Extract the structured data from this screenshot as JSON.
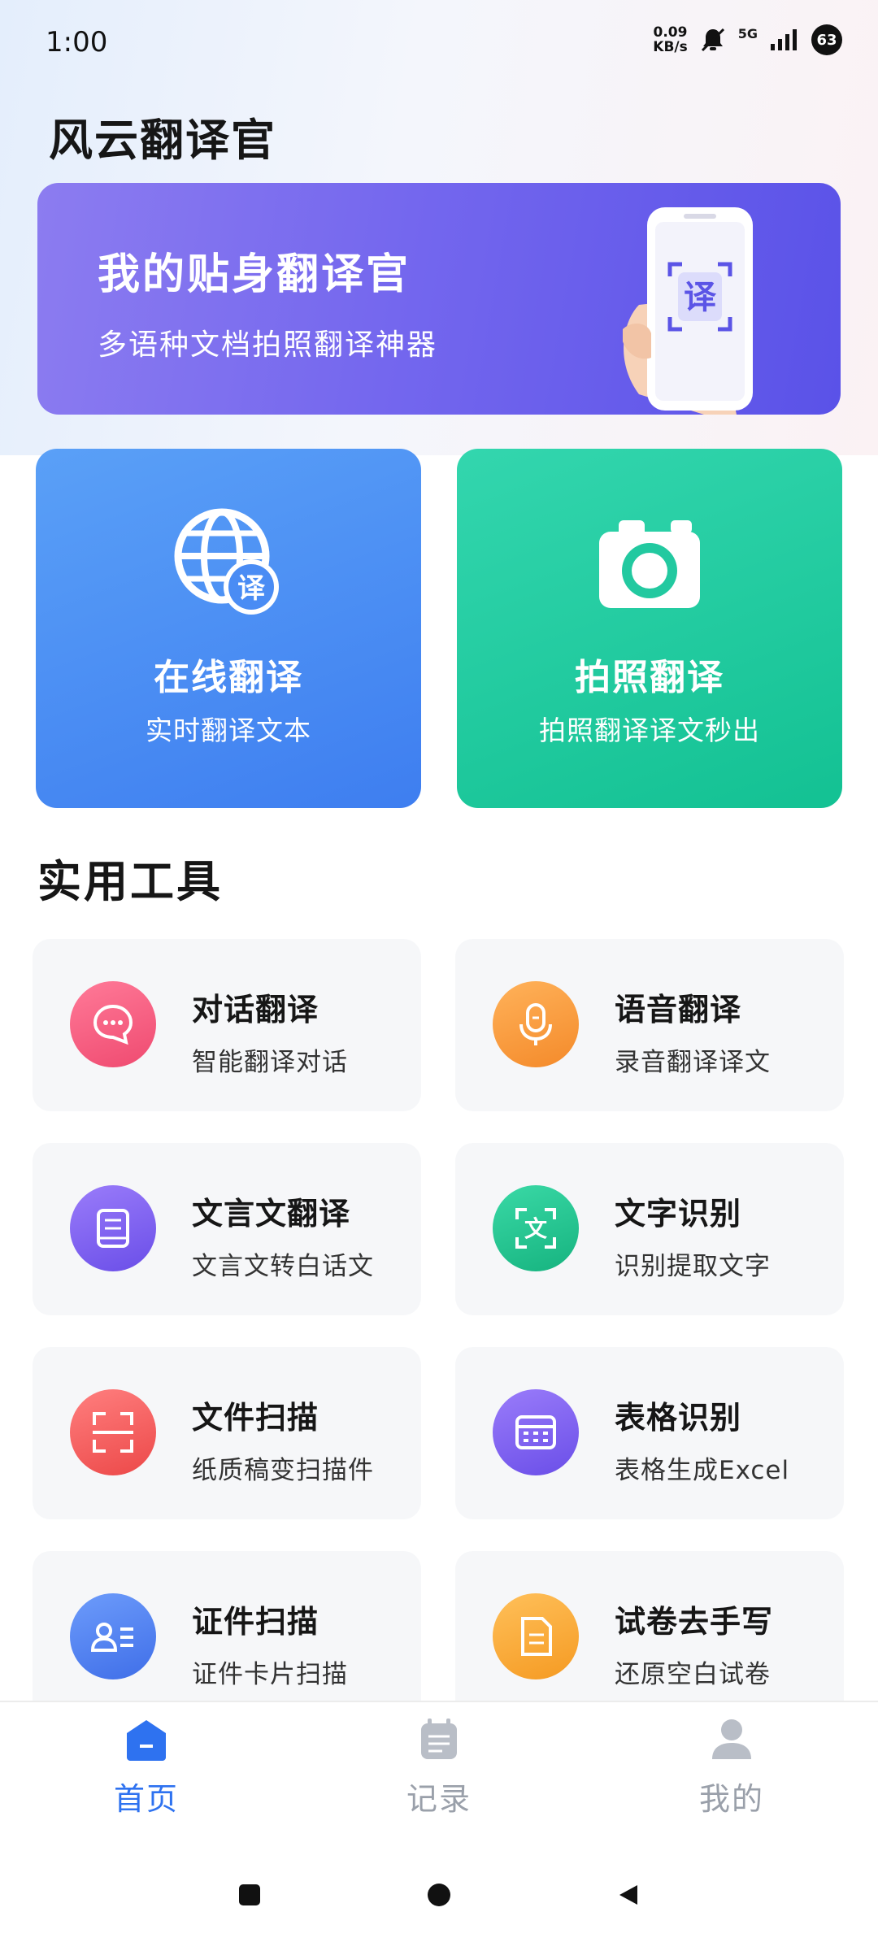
{
  "status_bar": {
    "time": "1:00",
    "net_speed_value": "0.09",
    "net_speed_unit": "KB/s",
    "network": "5G",
    "battery": "63"
  },
  "app": {
    "title": "风云翻译官"
  },
  "banner": {
    "title": "我的贴身翻译官",
    "subtitle": "多语种文档拍照翻译神器",
    "phone_glyph": "译"
  },
  "feature_cards": [
    {
      "title": "在线翻译",
      "subtitle": "实时翻译文本",
      "icon": "globe-translate-icon",
      "badge": "译",
      "color": "#4a8cf4"
    },
    {
      "title": "拍照翻译",
      "subtitle": "拍照翻译译文秒出",
      "icon": "camera-icon",
      "color": "#22c9a0"
    }
  ],
  "tools_section": {
    "title": "实用工具",
    "items": [
      {
        "title": "对话翻译",
        "subtitle": "智能翻译对话",
        "icon": "chat-bubble-icon",
        "color": "#f2567a"
      },
      {
        "title": "语音翻译",
        "subtitle": "录音翻译译文",
        "icon": "microphone-icon",
        "color": "#f99a3b"
      },
      {
        "title": "文言文翻译",
        "subtitle": "文言文转白话文",
        "icon": "book-icon",
        "color": "#7a5cf0"
      },
      {
        "title": "文字识别",
        "subtitle": "识别提取文字",
        "icon": "text-scan-icon",
        "color": "#22c28d",
        "glyph": "文"
      },
      {
        "title": "文件扫描",
        "subtitle": "纸质稿变扫描件",
        "icon": "document-scan-icon",
        "color": "#f55a5a"
      },
      {
        "title": "表格识别",
        "subtitle": "表格生成Excel",
        "icon": "table-icon",
        "color": "#7a5cf0"
      },
      {
        "title": "证件扫描",
        "subtitle": "证件卡片扫描",
        "icon": "id-card-icon",
        "color": "#4f7df2"
      },
      {
        "title": "试卷去手写",
        "subtitle": "还原空白试卷",
        "icon": "paper-icon",
        "color": "#f9a93a"
      }
    ]
  },
  "bottom_nav": [
    {
      "label": "首页",
      "icon": "home-icon",
      "active": true
    },
    {
      "label": "记录",
      "icon": "records-icon",
      "active": false
    },
    {
      "label": "我的",
      "icon": "profile-icon",
      "active": false
    }
  ]
}
